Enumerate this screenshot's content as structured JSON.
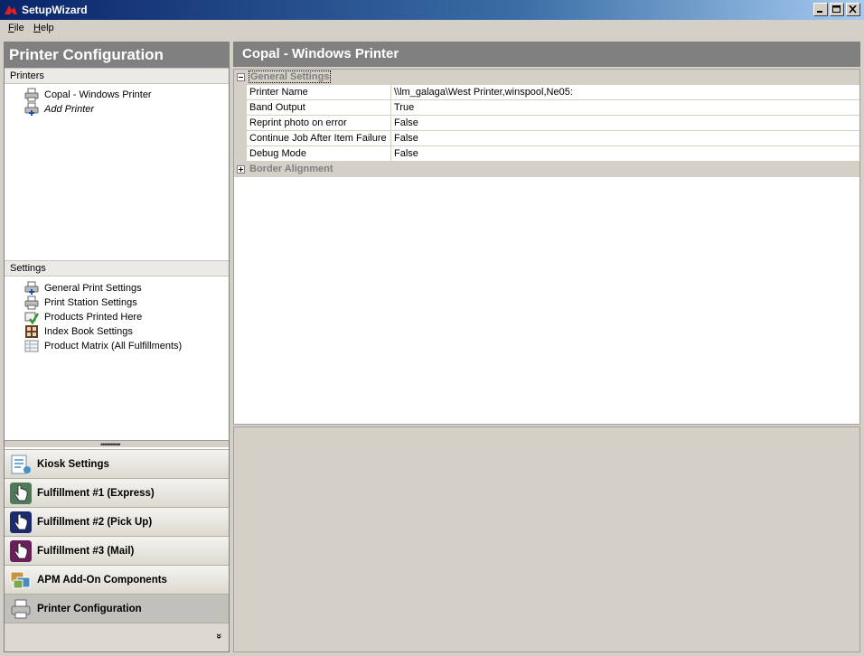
{
  "window": {
    "title": "SetupWizard"
  },
  "menu": [
    {
      "accel": "F",
      "rest": "ile"
    },
    {
      "accel": "H",
      "rest": "elp"
    }
  ],
  "left": {
    "header": "Printer Configuration",
    "printers_label": "Printers",
    "printers": [
      {
        "label": "Copal - Windows Printer",
        "icon": "printer-icon"
      },
      {
        "label": "Add Printer",
        "icon": "add-printer-icon"
      }
    ],
    "settings_label": "Settings",
    "settings": [
      {
        "label": "General Print Settings",
        "icon": "printer-settings-icon"
      },
      {
        "label": "Print Station Settings",
        "icon": "printer-icon"
      },
      {
        "label": "Products Printed Here",
        "icon": "products-check-icon"
      },
      {
        "label": "Index Book Settings",
        "icon": "index-book-icon"
      },
      {
        "label": "Product Matrix (All Fulfillments)",
        "icon": "product-matrix-icon"
      }
    ]
  },
  "nav": [
    {
      "label": "Kiosk Settings",
      "icon": "kiosk-icon",
      "color": "#4a90c8"
    },
    {
      "label": "Fulfillment #1 (Express)",
      "icon": "hand-pointer-icon",
      "color": "#4f7a5a"
    },
    {
      "label": "Fulfillment #2 (Pick Up)",
      "icon": "hand-pointer-icon",
      "color": "#1c2a6e"
    },
    {
      "label": "Fulfillment #3 (Mail)",
      "icon": "hand-pointer-icon",
      "color": "#6a1f5c"
    },
    {
      "label": "APM Add-On Components",
      "icon": "photos-icon",
      "color": "#c89440"
    },
    {
      "label": "Printer Configuration",
      "icon": "printer-icon",
      "color": "#9a9a9a"
    }
  ],
  "nav_overflow": "»",
  "right": {
    "header": "Copal - Windows Printer",
    "categories": [
      {
        "label": "General Settings",
        "expanded": true
      },
      {
        "label": "Border Alignment",
        "expanded": false
      }
    ],
    "properties": [
      {
        "name": "Printer Name",
        "value": "\\\\lm_galaga\\West Printer,winspool,Ne05:"
      },
      {
        "name": "Band Output",
        "value": "True"
      },
      {
        "name": "Reprint photo on error",
        "value": "False"
      },
      {
        "name": "Continue Job After Item Failure",
        "value": "False"
      },
      {
        "name": "Debug Mode",
        "value": "False"
      }
    ]
  }
}
